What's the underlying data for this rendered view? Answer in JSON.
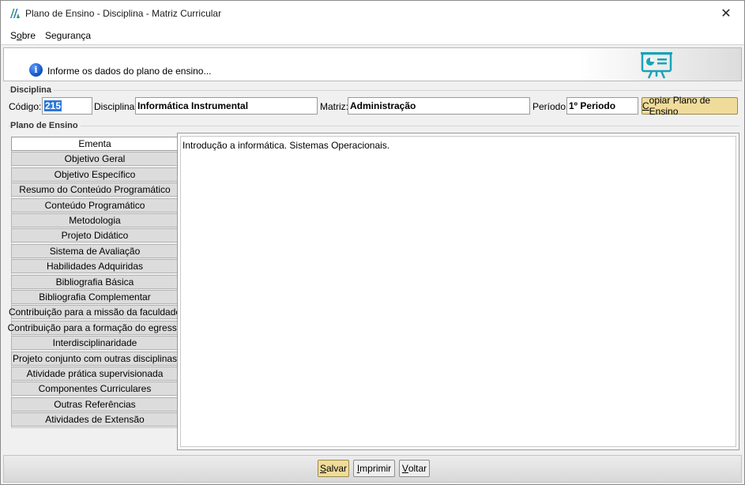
{
  "window": {
    "title": "Plano de Ensino - Disciplina - Matriz Curricular",
    "close_label": "✕"
  },
  "menu": {
    "items": [
      {
        "label_before": "S",
        "label_underlined": "o",
        "label_after": "bre"
      },
      {
        "label_before": "",
        "label_underlined": "",
        "label_after": "Segurança"
      }
    ]
  },
  "banner": {
    "info_glyph": "i",
    "message": "Informe os dados do plano de ensino..."
  },
  "disciplina_group": {
    "title": "Disciplina",
    "codigo_label": "Código:",
    "codigo_value": "215",
    "disciplina_label": "Disciplina:",
    "disciplina_value": "Informática Instrumental",
    "matriz_label": "Matriz:",
    "matriz_value": "Administração",
    "periodo_label": "Período:",
    "periodo_value": "1º Periodo",
    "copy_button": {
      "before": "",
      "underlined": "C",
      "after": "opiar Plano de Ensino"
    }
  },
  "plano_group": {
    "title": "Plano de Ensino",
    "tabs": [
      "Ementa",
      "Objetivo Geral",
      "Objetivo Específico",
      "Resumo do Conteúdo Programático",
      "Conteúdo Programático",
      "Metodologia",
      "Projeto Didático",
      "Sistema de Avaliação",
      "Habilidades Adquiridas",
      "Bibliografia Básica",
      "Bibliografia Complementar",
      "Contribuição para a missão da faculdade",
      "Contribuição para a formação do egresso",
      "Interdisciplinaridade",
      "Projeto conjunto com outras disciplinas",
      "Atividade prática supervisionada",
      "Componentes Curriculares",
      "Outras Referências",
      "Atividades de Extensão"
    ],
    "active_tab": "Ementa",
    "editor_text": "Introdução a informática. Sistemas Operacionais."
  },
  "actions": {
    "save": {
      "underlined": "S",
      "after": "alvar"
    },
    "print": {
      "underlined": "I",
      "after": "mprimir"
    },
    "back": {
      "underlined": "V",
      "after": "oltar"
    }
  },
  "colors": {
    "accent_button": "#f0dc9a",
    "selection": "#2d76d6",
    "info_icon": "#0b4fc4",
    "board_icon": "#1aa3b8"
  }
}
